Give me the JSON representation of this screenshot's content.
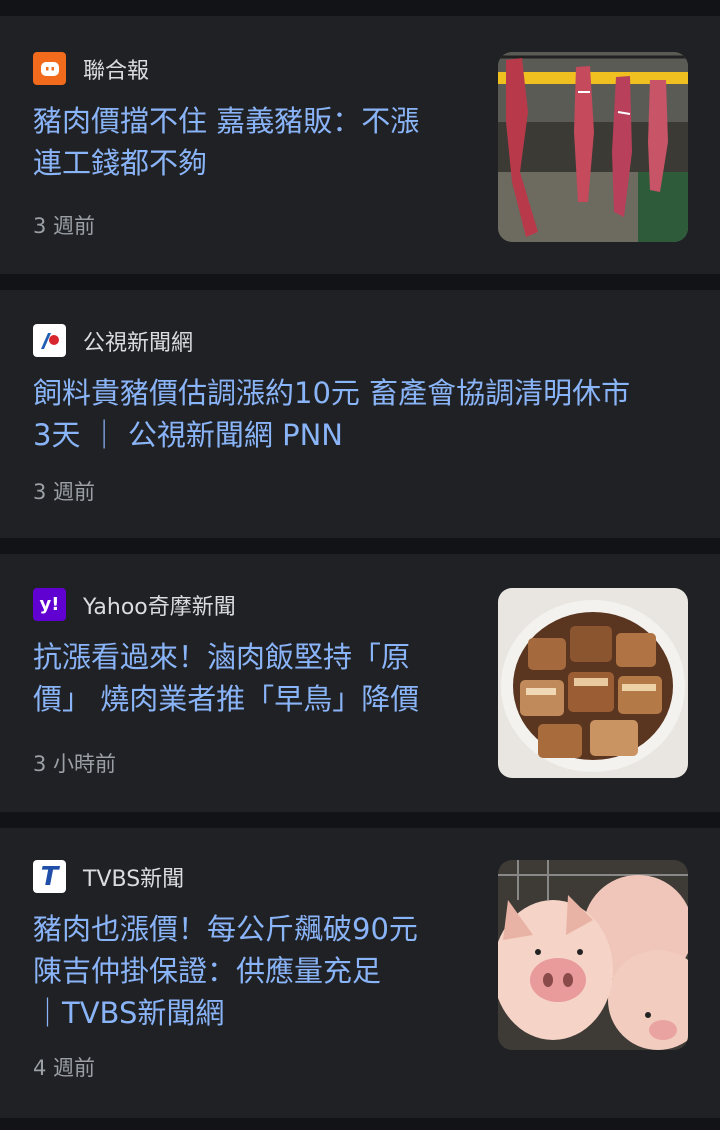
{
  "articles": [
    {
      "source": "聯合報",
      "headline_lines": [
        "豬肉價擋不住 嘉義豬販：不漲",
        "連工錢都不夠"
      ],
      "time": "3 週前",
      "thumbnail": "hanging-pork-image",
      "logo_color": "#f26b1d"
    },
    {
      "source": "公視新聞網",
      "headline_lines": [
        "飼料貴豬價估調漲約10元 畜產會協調清明休市",
        "3天 ｜ 公視新聞網 PNN"
      ],
      "time": "3 週前",
      "logo_color": "#ffffff"
    },
    {
      "source": "Yahoo奇摩新聞",
      "headline_lines": [
        "抗漲看過來！滷肉飯堅持「原",
        "價」 燒肉業者推「早鳥」降價"
      ],
      "time": "3 小時前",
      "thumbnail": "braised-pork-image",
      "logo_color": "#6001d2",
      "logo_text": "y!"
    },
    {
      "source": "TVBS新聞",
      "headline_lines": [
        "豬肉也漲價！每公斤飆破90元",
        "陳吉仲掛保證：供應量充足",
        "｜TVBS新聞網"
      ],
      "time": "4 週前",
      "thumbnail": "pigs-image",
      "logo_color": "#ffffff",
      "logo_text": "T"
    }
  ],
  "colors": {
    "headline": "#8ab4f8",
    "card_bg": "#202124",
    "page_bg": "#121316",
    "muted": "#9aa0a6"
  }
}
